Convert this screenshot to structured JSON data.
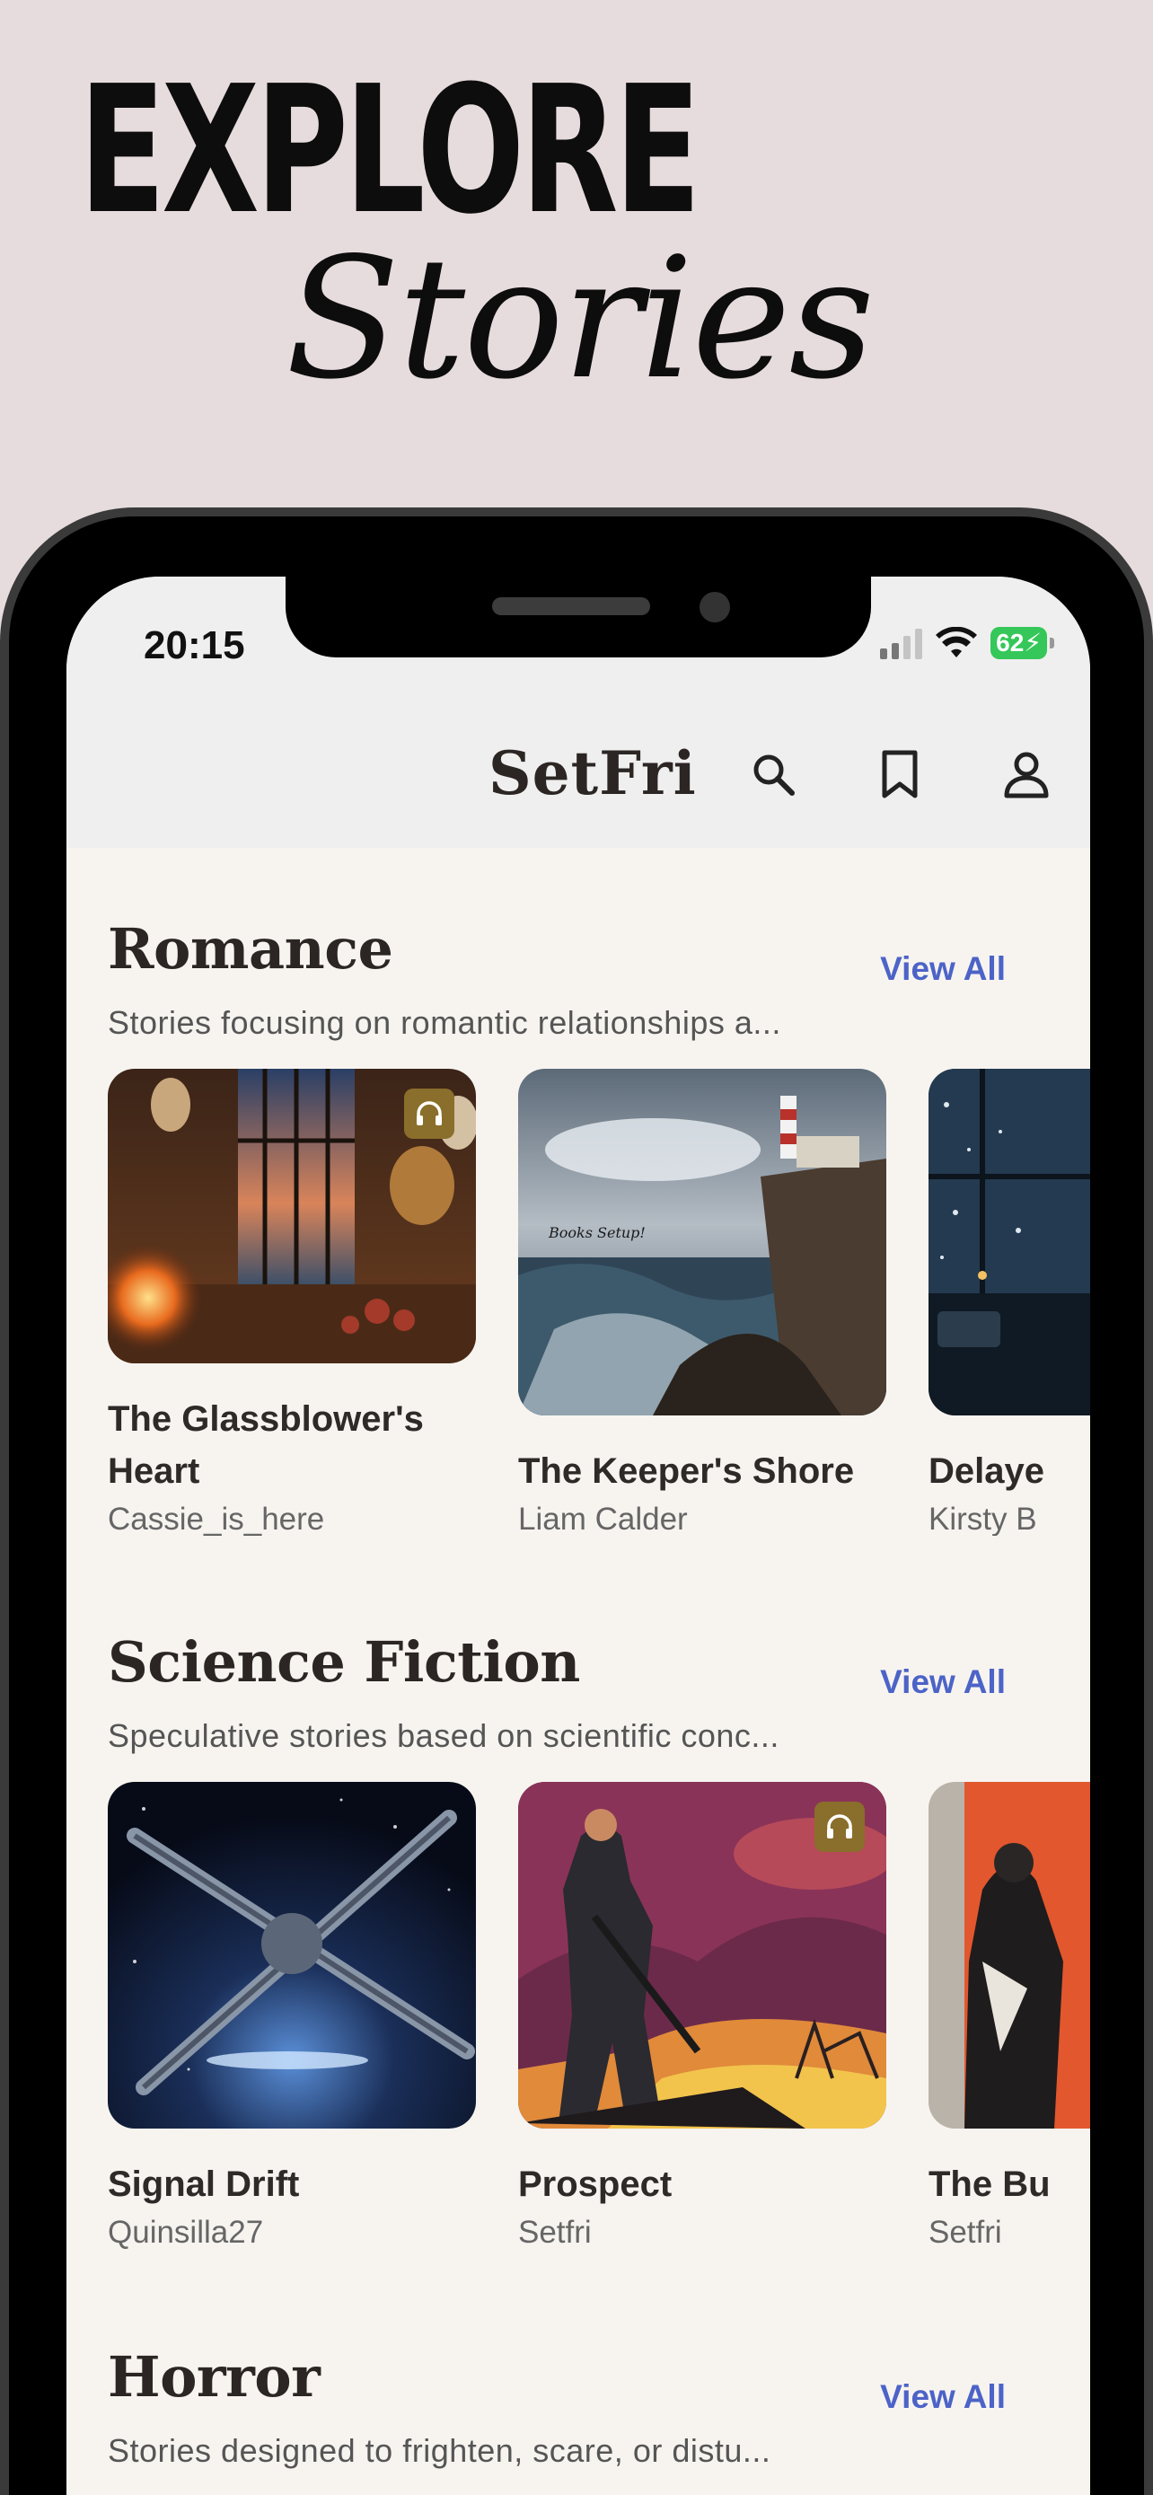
{
  "promo": {
    "line1": "EXPLORE",
    "line2": "Stories"
  },
  "status": {
    "time": "20:15",
    "battery": "62"
  },
  "header": {
    "brand": "SetFri"
  },
  "sections": [
    {
      "title": "Romance",
      "view_all": "View All",
      "description": "Stories focusing on romantic relationships a...",
      "cards": [
        {
          "title_line1": "The Glassblower's",
          "title_line2": "Heart",
          "author": "Cassie_is_here",
          "audio": true
        },
        {
          "title_line1": "The Keeper's Shore",
          "title_line2": "",
          "author": "Liam Calder",
          "audio": false,
          "cover_text": "Books Setup!"
        },
        {
          "title_line1": "Delaye",
          "title_line2": "",
          "author": "Kirsty B",
          "audio": false
        }
      ]
    },
    {
      "title": "Science Fiction",
      "view_all": "View All",
      "description": "Speculative stories based on scientific conc...",
      "cards": [
        {
          "title_line1": "Signal Drift",
          "author": "Quinsilla27",
          "audio": false
        },
        {
          "title_line1": "Prospect",
          "author": "Setfri",
          "audio": true
        },
        {
          "title_line1": "The Bu",
          "author": "Setfri",
          "audio": false
        }
      ]
    },
    {
      "title": "Horror",
      "view_all": "View All",
      "description": "Stories designed to frighten, scare, or distu..."
    }
  ],
  "colors": {
    "accent": "#4c63c7",
    "background": "#e7dcdd",
    "audio_badge": "#8a6e2b"
  },
  "icons": [
    "search-icon",
    "bookmark-icon",
    "profile-icon",
    "headphones-icon",
    "wifi-icon",
    "signal-icon",
    "battery-icon"
  ]
}
